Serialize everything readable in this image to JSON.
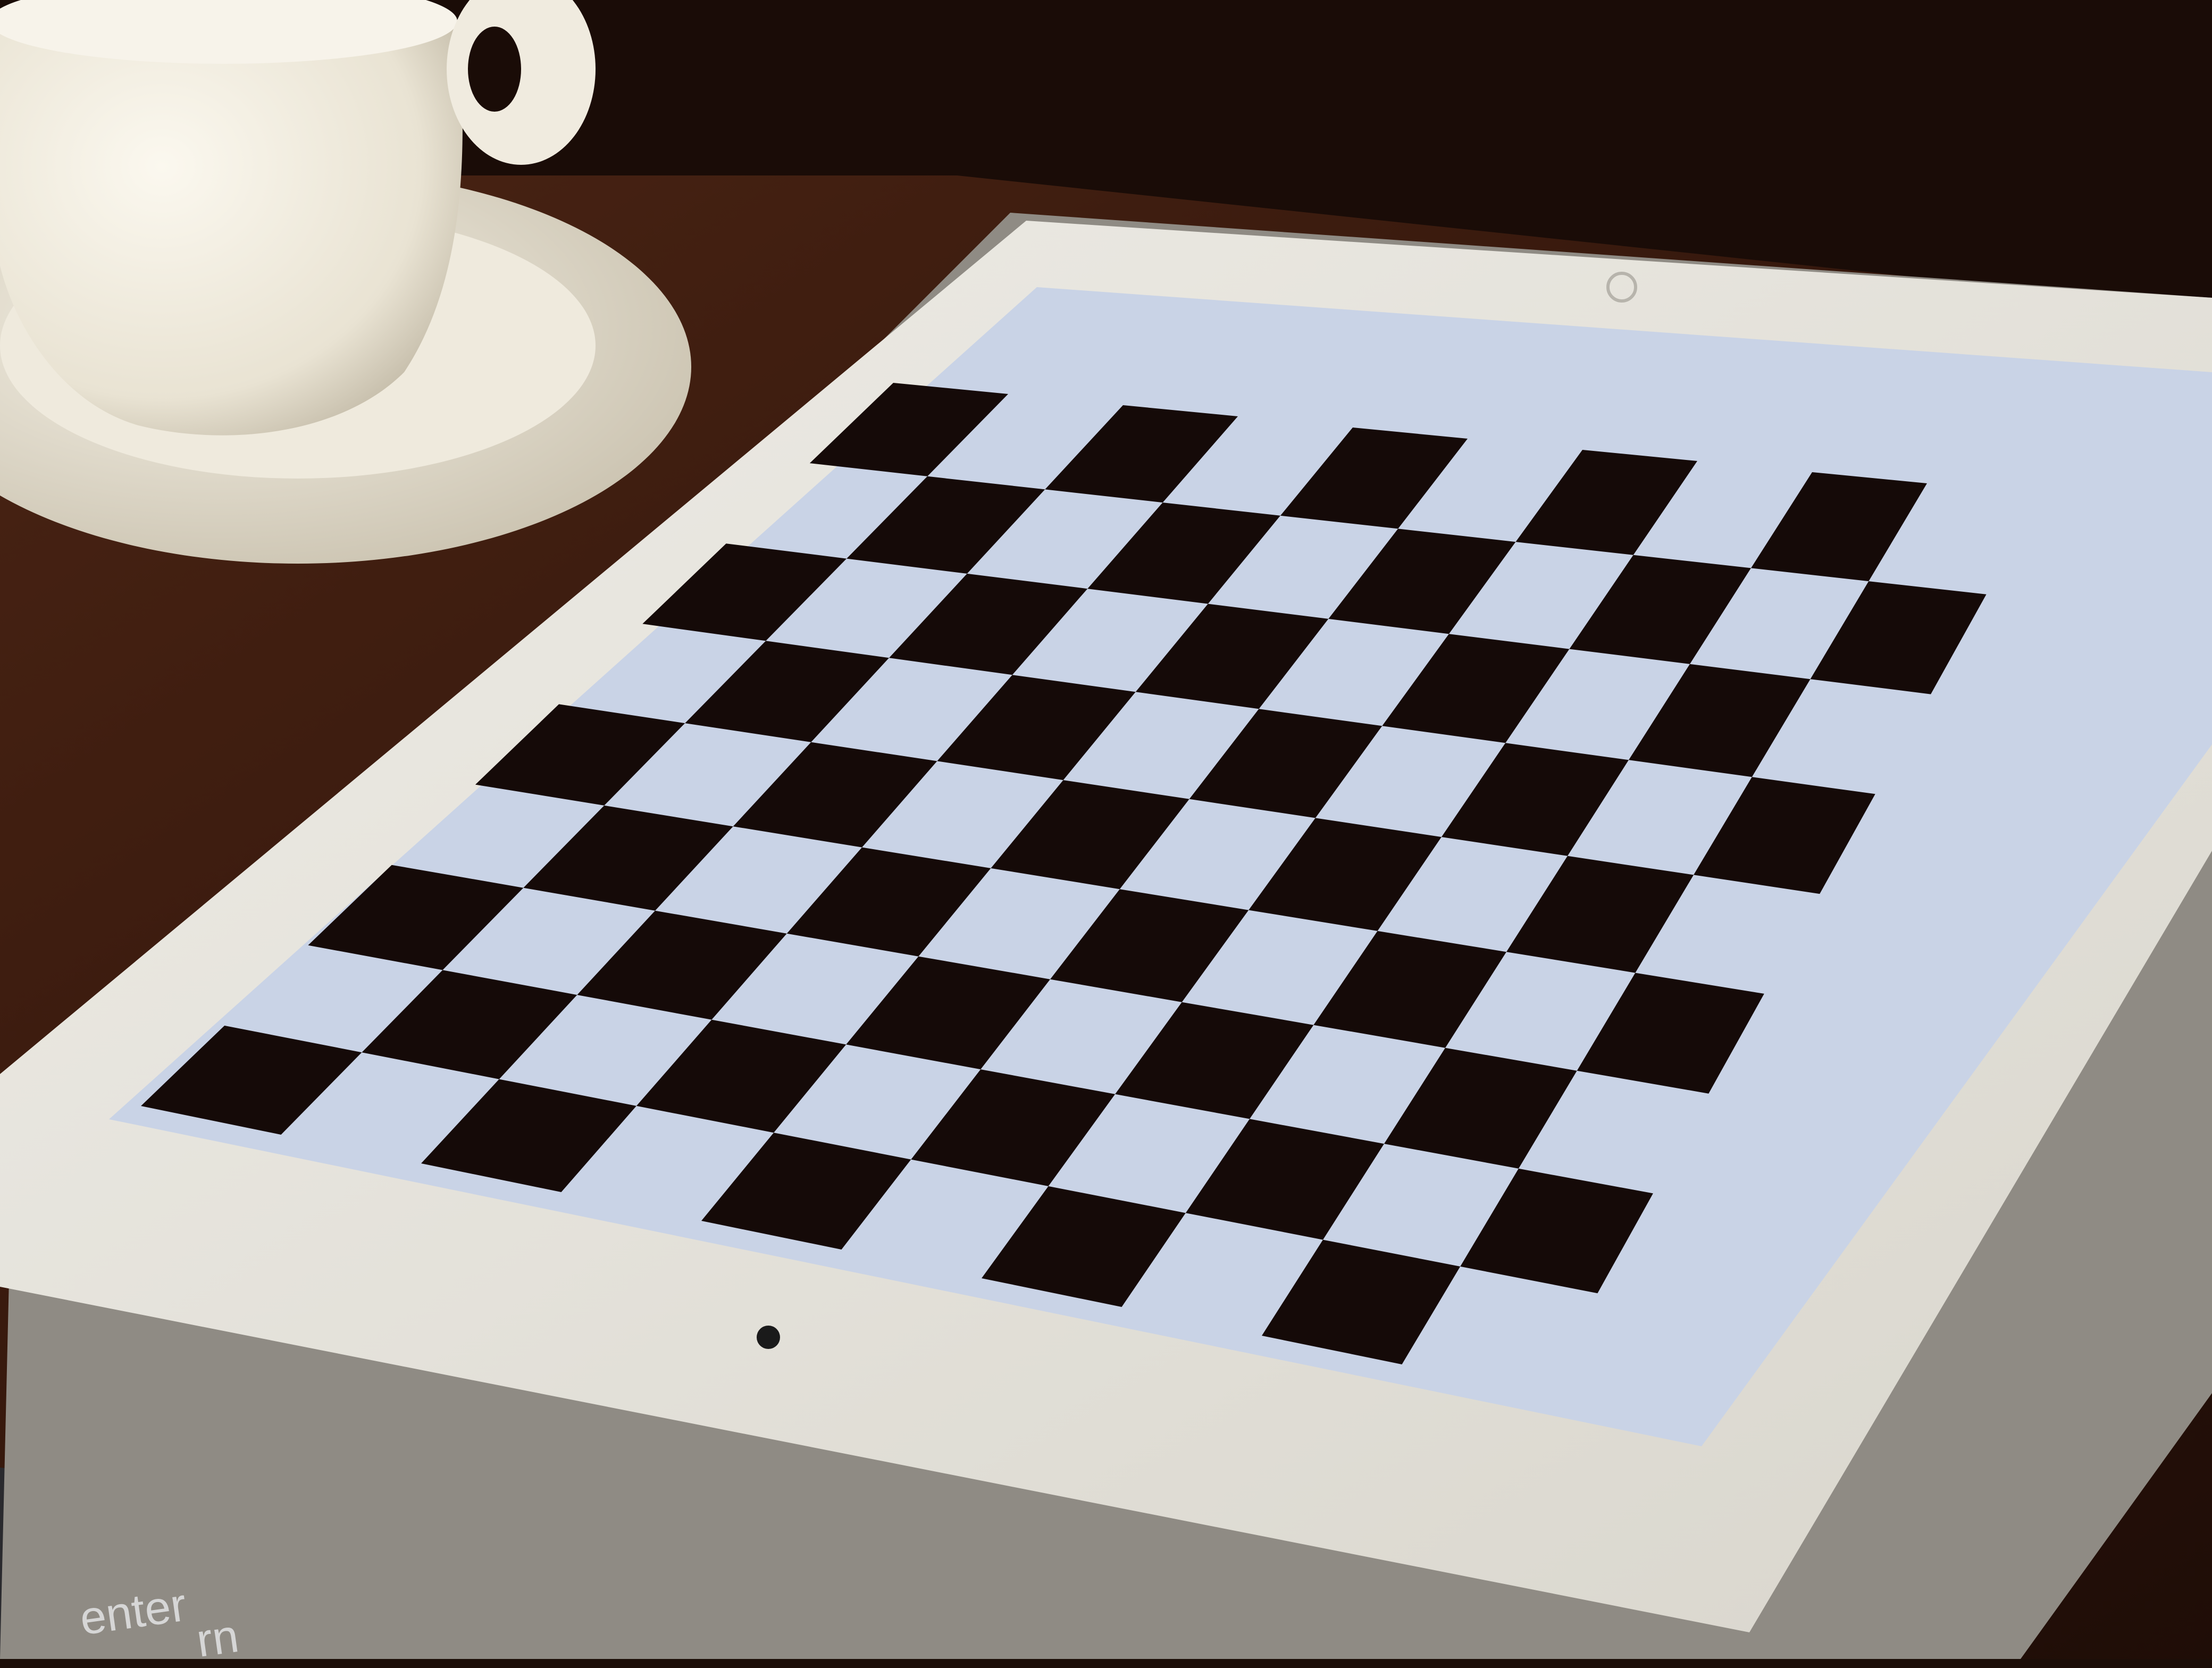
{
  "scene": {
    "objects": [
      "espresso-cup",
      "saucer",
      "wooden-table",
      "tablet",
      "keyboard"
    ],
    "colors": {
      "table": "#3a1a0e",
      "tablet_bezel": "#e8e6e0",
      "screen_light": "#c9d3e6",
      "square_dark": "#150a08",
      "cup": "#f3efe4"
    }
  },
  "tablet": {
    "screen": {
      "content": "checkerboard",
      "grid": {
        "rows": 9,
        "columns": 10
      }
    },
    "icons": [
      "camera-icon",
      "home-button-icon"
    ]
  },
  "keyboard": {
    "visible_key_labels": [
      "enter",
      "rn"
    ]
  }
}
